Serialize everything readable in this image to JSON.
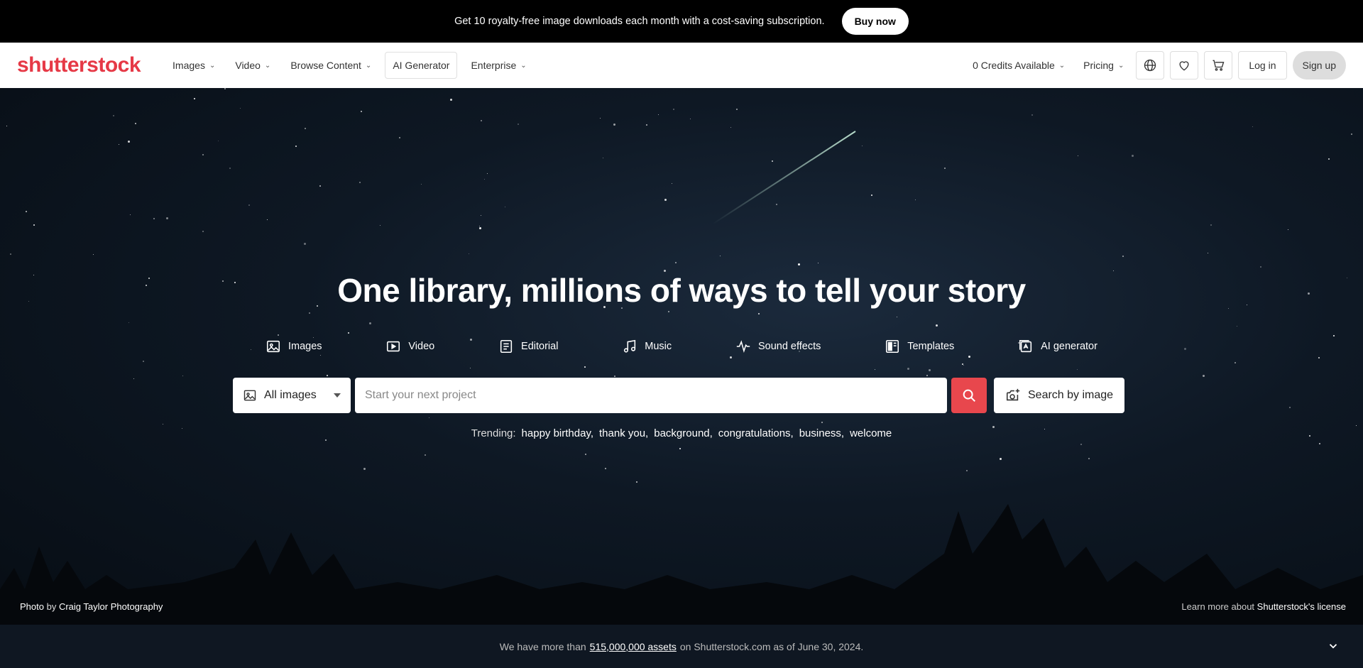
{
  "promo": {
    "text": "Get 10 royalty-free image downloads each month with a cost-saving subscription.",
    "buy_label": "Buy now"
  },
  "nav": {
    "logo": "shutterstock",
    "items": [
      {
        "label": "Images",
        "has_menu": true
      },
      {
        "label": "Video",
        "has_menu": true
      },
      {
        "label": "Browse Content",
        "has_menu": true
      },
      {
        "label": "AI Generator",
        "has_menu": false
      },
      {
        "label": "Enterprise",
        "has_menu": true
      }
    ],
    "credits_label": "0 Credits Available",
    "pricing_label": "Pricing",
    "login_label": "Log in",
    "signup_label": "Sign up"
  },
  "hero": {
    "title": "One library, millions of ways to tell your story",
    "categories": [
      {
        "label": "Images",
        "icon": "image-icon"
      },
      {
        "label": "Video",
        "icon": "video-icon"
      },
      {
        "label": "Editorial",
        "icon": "editorial-icon"
      },
      {
        "label": "Music",
        "icon": "music-icon"
      },
      {
        "label": "Sound effects",
        "icon": "waveform-icon"
      },
      {
        "label": "Templates",
        "icon": "templates-icon"
      },
      {
        "label": "AI generator",
        "icon": "ai-generator-icon"
      }
    ],
    "search": {
      "dropdown_value": "All images",
      "placeholder": "Start your next project",
      "image_search_label": "Search by image"
    },
    "trending_label": "Trending:",
    "trending": [
      "happy birthday,",
      "thank you,",
      "background,",
      "congratulations,",
      "business,",
      "welcome"
    ],
    "credit_photo": "Photo",
    "credit_by": "by",
    "credit_author": "Craig Taylor Photography",
    "license_text": "Learn more about",
    "license_link": "Shutterstock's license"
  },
  "footer": {
    "text_before": "We have more than",
    "assets_link": "515,000,000 assets",
    "text_after": "on Shutterstock.com as of June 30, 2024."
  },
  "colors": {
    "brand": "#e8474d",
    "promo_bg": "#000000",
    "footer_bg": "#0f1722"
  }
}
